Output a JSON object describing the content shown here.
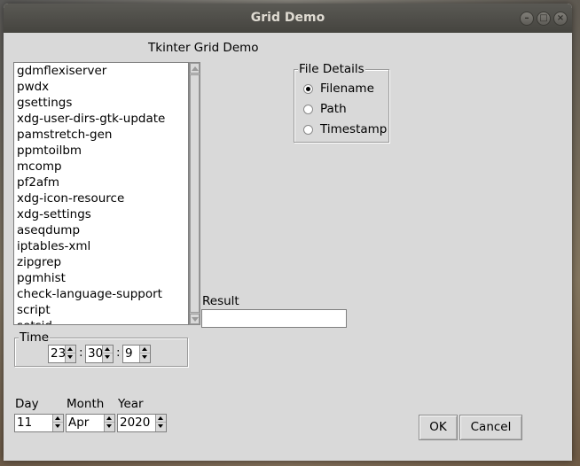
{
  "window": {
    "title": "Grid Demo",
    "controls": {
      "minimize": "–",
      "maximize": "□",
      "close": "×"
    }
  },
  "header": {
    "title": "Tkinter Grid Demo"
  },
  "listbox": {
    "items": [
      "gdmflexiserver",
      "pwdx",
      "gsettings",
      "xdg-user-dirs-gtk-update",
      "pamstretch-gen",
      "ppmtoilbm",
      "mcomp",
      "pf2afm",
      "xdg-icon-resource",
      "xdg-settings",
      "aseqdump",
      "iptables-xml",
      "zipgrep",
      "pgmhist",
      "check-language-support",
      "script",
      "setsid"
    ]
  },
  "file_details": {
    "legend": "File Details",
    "options": [
      "Filename",
      "Path",
      "Timestamp"
    ],
    "selected": "Filename"
  },
  "result": {
    "label": "Result",
    "value": ""
  },
  "time": {
    "legend": "Time",
    "hour": "23",
    "minute": "30",
    "second": "9",
    "separator": ":"
  },
  "date": {
    "day_label": "Day",
    "month_label": "Month",
    "year_label": "Year",
    "day": "11",
    "month": "Apr",
    "year": "2020"
  },
  "buttons": {
    "ok": "OK",
    "cancel": "Cancel"
  },
  "colors": {
    "window_bg": "#d9d9d9",
    "titlebar": "#4f4e49",
    "title_text": "#dfdbd2"
  }
}
